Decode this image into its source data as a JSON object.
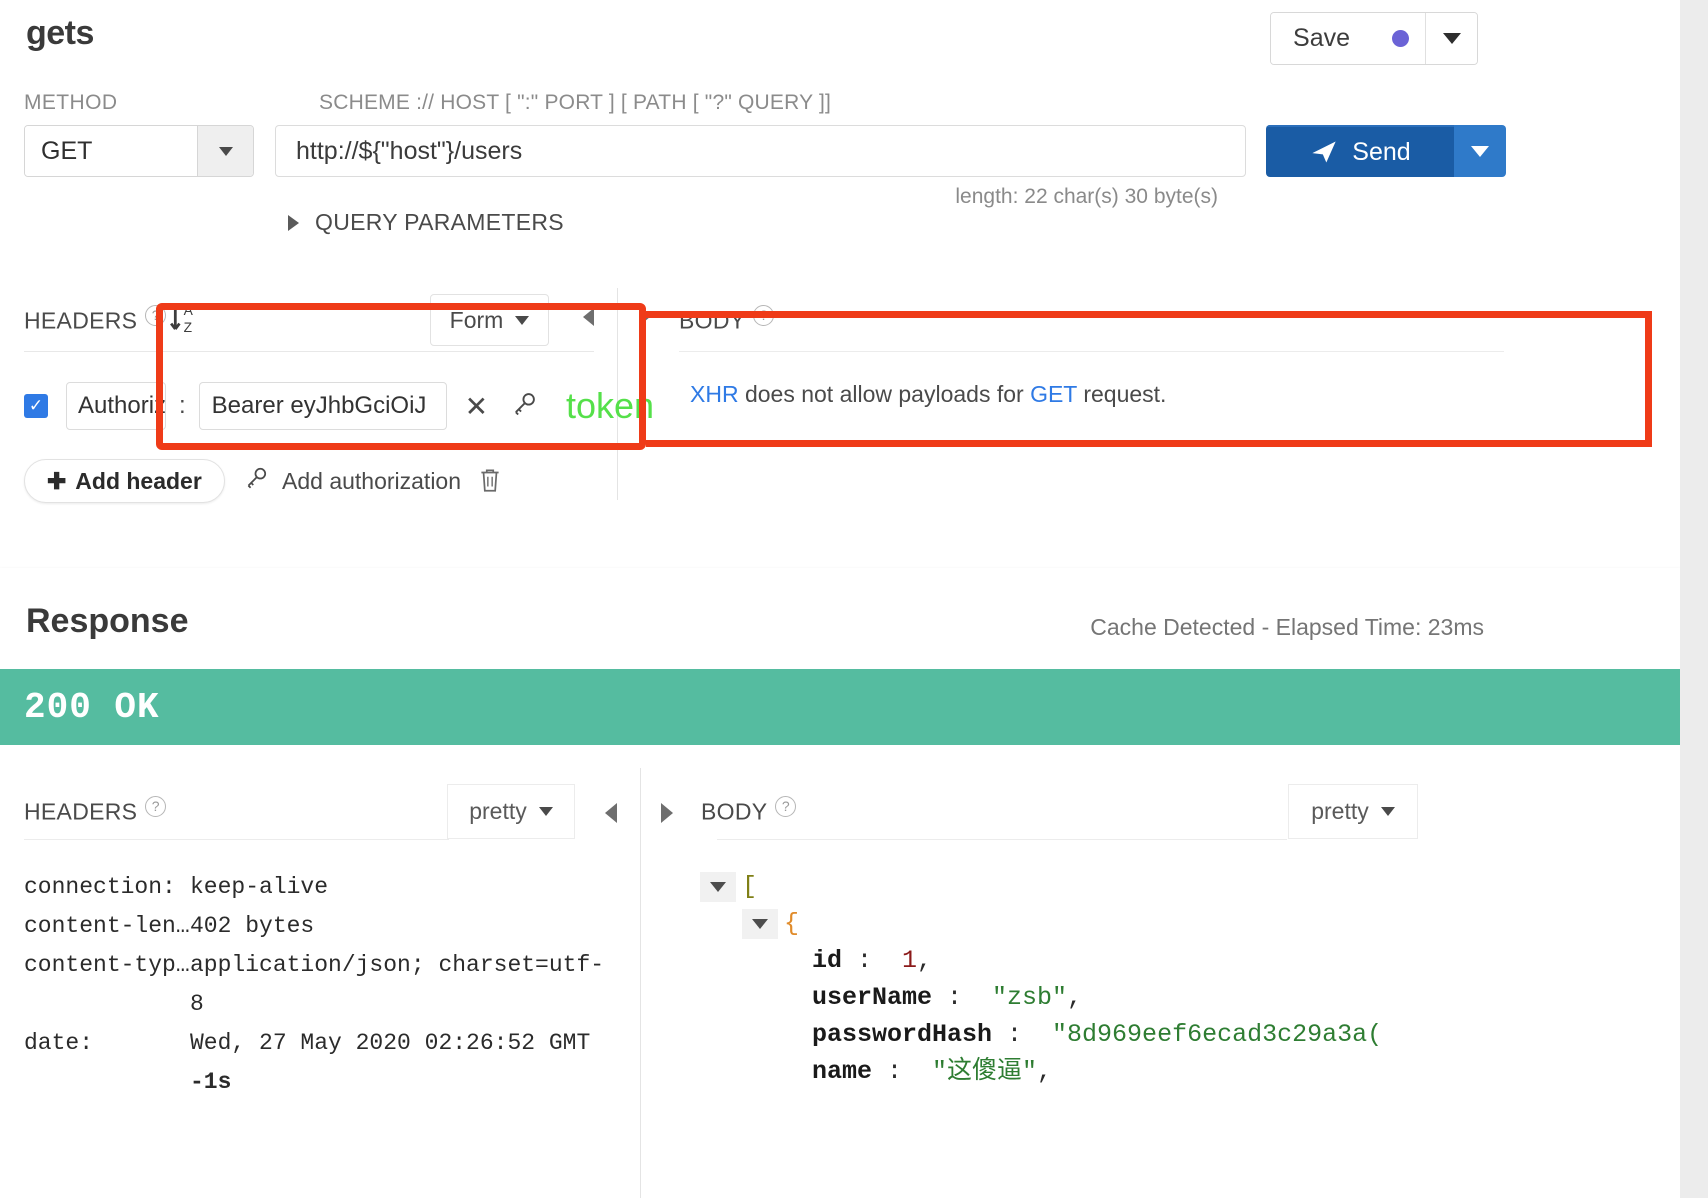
{
  "request": {
    "title": "gets",
    "save": {
      "label": "Save",
      "dot_color": "#6b63d6"
    },
    "labels": {
      "method": "METHOD",
      "scheme": "SCHEME :// HOST [ \":\" PORT ] [ PATH [ \"?\" QUERY ]]"
    },
    "method": {
      "value": "GET"
    },
    "url": {
      "value": "http://${\"host\"}/users"
    },
    "send": {
      "label": "Send"
    },
    "length_note": "length: 22 char(s) 30 byte(s)",
    "query_parameters_label": "QUERY PARAMETERS",
    "headers": {
      "label": "HEADERS",
      "form_select": "Form",
      "rows": [
        {
          "enabled": true,
          "key": "Authoriza",
          "value": "Bearer eyJhbGciOiJ"
        }
      ],
      "add_header_label": "Add header",
      "add_authorization_label": "Add authorization"
    },
    "body": {
      "label": "BODY",
      "message_pre": "XHR",
      "message_mid": " does not allow payloads for ",
      "message_link2": "GET",
      "message_post": " request."
    },
    "annotation": {
      "text": "token",
      "color": "#55e04a",
      "box_color": "#ef3b18"
    }
  },
  "response": {
    "title": "Response",
    "meta": "Cache Detected - Elapsed Time: 23ms",
    "status": "200 OK",
    "status_color": "#55bca0",
    "headers": {
      "label": "HEADERS",
      "format": "pretty",
      "rows": [
        {
          "key": "connection:",
          "value": "keep-alive",
          "sub": ""
        },
        {
          "key": "content-len…",
          "value": "402 bytes",
          "sub": ""
        },
        {
          "key": "content-typ…",
          "value": "application/json; charset=utf-8",
          "sub": ""
        },
        {
          "key": "date:",
          "value": "Wed, 27 May 2020 02:26:52 GMT",
          "sub": "-1s"
        }
      ]
    },
    "body": {
      "label": "BODY",
      "format": "pretty",
      "open_array": "[",
      "open_object": "{",
      "fields": [
        {
          "key": "id",
          "value": "1",
          "type": "num",
          "comma": ","
        },
        {
          "key": "userName",
          "value": "\"zsb\"",
          "type": "str",
          "comma": ","
        },
        {
          "key": "passwordHash",
          "value": "\"8d969eef6ecad3c29a3a(",
          "type": "str",
          "comma": ""
        },
        {
          "key": "name",
          "value": "\"这傻逼\"",
          "type": "str",
          "comma": ","
        }
      ]
    }
  },
  "icons": {
    "sort": "sort-az-icon",
    "key": "key-icon",
    "trash": "trash-icon",
    "plus": "plus-icon",
    "send": "paper-plane-icon",
    "help": "help-icon"
  }
}
